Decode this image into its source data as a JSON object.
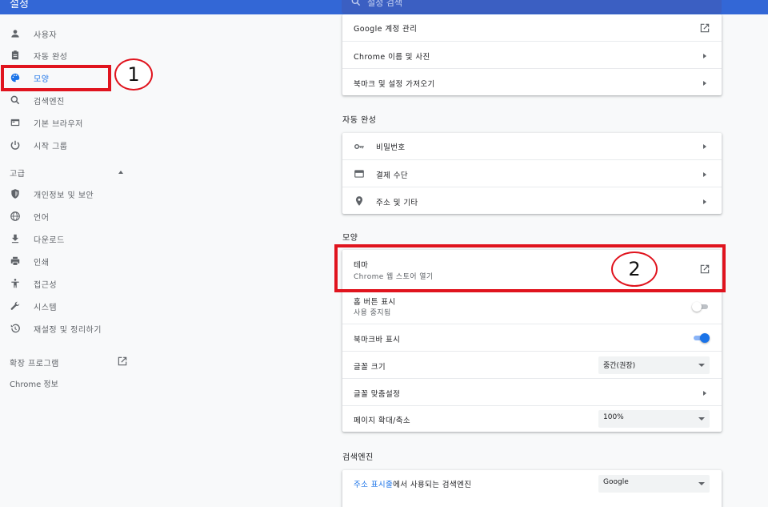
{
  "header": {
    "title": "설정",
    "search_placeholder": "설정 검색"
  },
  "sidebar": {
    "items": [
      {
        "label": "사용자",
        "icon": "person-icon"
      },
      {
        "label": "자동 완성",
        "icon": "clipboard-icon"
      },
      {
        "label": "모양",
        "icon": "palette-icon",
        "active": true
      },
      {
        "label": "검색엔진",
        "icon": "search-icon"
      },
      {
        "label": "기본 브라우저",
        "icon": "browser-icon"
      },
      {
        "label": "시작 그룹",
        "icon": "power-icon"
      }
    ],
    "advanced_label": "고급",
    "advanced_items": [
      {
        "label": "개인정보 및 보안",
        "icon": "shield-icon"
      },
      {
        "label": "언어",
        "icon": "globe-icon"
      },
      {
        "label": "다운로드",
        "icon": "download-icon"
      },
      {
        "label": "인쇄",
        "icon": "printer-icon"
      },
      {
        "label": "접근성",
        "icon": "accessibility-icon"
      },
      {
        "label": "시스템",
        "icon": "wrench-icon"
      },
      {
        "label": "재설정 및 정리하기",
        "icon": "restore-icon"
      }
    ],
    "extensions_label": "확장 프로그램",
    "about_label": "Chrome 정보"
  },
  "people_card": {
    "rows": [
      "Google 계정 관리",
      "Chrome 이름 및 사진",
      "북마크 및 설정 가져오기"
    ]
  },
  "autofill": {
    "heading": "자동 완성",
    "rows": [
      {
        "label": "비밀번호",
        "icon": "key-icon"
      },
      {
        "label": "결제 수단",
        "icon": "credit-card-icon"
      },
      {
        "label": "주소 및 기타",
        "icon": "location-pin-icon"
      }
    ]
  },
  "appearance": {
    "heading": "모양",
    "theme_title": "테마",
    "theme_sub": "Chrome 웹 스토어 열기",
    "home_title": "홈 버튼 표시",
    "home_sub": "사용 중지됨",
    "home_toggle_on": false,
    "bookmarks_bar_title": "북마크바 표시",
    "bookmarks_bar_on": true,
    "font_size_title": "글꼴 크기",
    "font_size_value": "중간(권장)",
    "customize_fonts_title": "글꼴 맞춤설정",
    "zoom_title": "페이지 확대/축소",
    "zoom_value": "100%"
  },
  "search_engine": {
    "heading": "검색엔진",
    "row_link": "주소 표시줄",
    "row_rest": "에서 사용되는 검색엔진",
    "value": "Google"
  },
  "annotations": {
    "marker_1": "1",
    "marker_2": "2"
  },
  "colors": {
    "accent": "#1a73e8",
    "header": "#3367d6",
    "highlight": "#e0141e"
  }
}
